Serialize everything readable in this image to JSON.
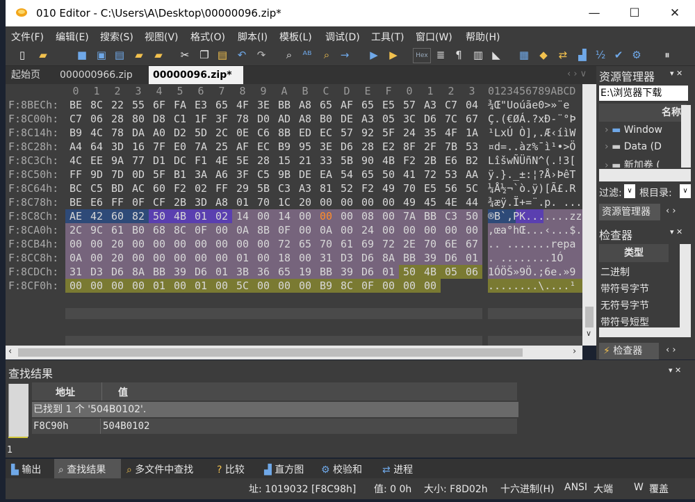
{
  "window": {
    "title": "010 Editor - C:\\Users\\A\\Desktop\\00000096.zip*"
  },
  "menu": [
    "文件(F)",
    "编辑(E)",
    "搜索(S)",
    "视图(V)",
    "格式(O)",
    "脚本(I)",
    "模板(L)",
    "调试(D)",
    "工具(T)",
    "窗口(W)",
    "帮助(H)"
  ],
  "tabs": [
    {
      "label": "起始页"
    },
    {
      "label": "000000966.zip"
    },
    {
      "label": "00000096.zip*"
    }
  ],
  "hex": {
    "col_headers": [
      "0",
      "1",
      "2",
      "3",
      "4",
      "5",
      "6",
      "7",
      "8",
      "9",
      "A",
      "B",
      "C",
      "D",
      "E",
      "F",
      "0",
      "1",
      "2",
      "3"
    ],
    "ascii_header": "0123456789ABCD",
    "rows": [
      {
        "addr": "F:8BECh:",
        "bytes": [
          "BE",
          "8C",
          "22",
          "55",
          "6F",
          "FA",
          "E3",
          "65",
          "4F",
          "3E",
          "BB",
          "A8",
          "65",
          "AF",
          "65",
          "E5",
          "57",
          "A3",
          "C7",
          "04"
        ],
        "ascii": "¾Œ\"Uoúãe0>»¨e"
      },
      {
        "addr": "F:8C00h:",
        "bytes": [
          "C7",
          "06",
          "28",
          "80",
          "D8",
          "C1",
          "1F",
          "3F",
          "78",
          "D0",
          "AD",
          "A8",
          "B0",
          "DE",
          "A3",
          "05",
          "3C",
          "D6",
          "7C",
          "67"
        ],
        "ascii": "Ç.(€ØÁ.?xÐ-¨°Þ"
      },
      {
        "addr": "F:8C14h:",
        "bytes": [
          "B9",
          "4C",
          "78",
          "DA",
          "A0",
          "D2",
          "5D",
          "2C",
          "0E",
          "C6",
          "8B",
          "ED",
          "EC",
          "57",
          "92",
          "5F",
          "24",
          "35",
          "4F",
          "1A"
        ],
        "ascii": "¹LxÚ Ò],.Æ‹íìW"
      },
      {
        "addr": "F:8C28h:",
        "bytes": [
          "A4",
          "64",
          "3D",
          "16",
          "7F",
          "E0",
          "7A",
          "25",
          "AF",
          "EC",
          "B9",
          "95",
          "3E",
          "D6",
          "28",
          "E2",
          "8F",
          "2F",
          "7B",
          "53"
        ],
        "ascii": "¤d=..àz%¯ì¹•>Ö"
      },
      {
        "addr": "F:8C3Ch:",
        "bytes": [
          "4C",
          "EE",
          "9A",
          "77",
          "D1",
          "DC",
          "F1",
          "4E",
          "5E",
          "28",
          "15",
          "21",
          "33",
          "5B",
          "90",
          "4B",
          "F2",
          "2B",
          "E6",
          "B2"
        ],
        "ascii": "LîšwÑÜñN^(.!3["
      },
      {
        "addr": "F:8C50h:",
        "bytes": [
          "FF",
          "9D",
          "7D",
          "0D",
          "5F",
          "B1",
          "3A",
          "A6",
          "3F",
          "C5",
          "9B",
          "DE",
          "EA",
          "54",
          "65",
          "50",
          "41",
          "72",
          "53",
          "AA"
        ],
        "ascii": "ÿ.}._±:¦?Å›ÞêT"
      },
      {
        "addr": "F:8C64h:",
        "bytes": [
          "BC",
          "C5",
          "BD",
          "AC",
          "60",
          "F2",
          "02",
          "FF",
          "29",
          "5B",
          "C3",
          "A3",
          "81",
          "52",
          "F2",
          "49",
          "70",
          "E5",
          "56",
          "5C"
        ],
        "ascii": "¼Å½¬`ò.ÿ)[Ã£.R"
      },
      {
        "addr": "F:8C78h:",
        "bytes": [
          "BE",
          "E6",
          "FF",
          "0F",
          "CF",
          "2B",
          "3D",
          "A8",
          "01",
          "70",
          "1C",
          "20",
          "00",
          "00",
          "00",
          "00",
          "49",
          "45",
          "4E",
          "44"
        ],
        "ascii": "¾æÿ.Ï+=¨.p. ...."
      },
      {
        "addr": "F:8C8Ch:",
        "bytes": [
          "AE",
          "42",
          "60",
          "82",
          "50",
          "4B",
          "01",
          "02",
          "14",
          "00",
          "14",
          "00",
          "00",
          "00",
          "08",
          "00",
          "7A",
          "BB",
          "C3",
          "50"
        ],
        "ascii": "®B`‚PK.......zzz"
      },
      {
        "addr": "F:8CA0h:",
        "bytes": [
          "2C",
          "9C",
          "61",
          "B0",
          "68",
          "8C",
          "0F",
          "00",
          "0A",
          "8B",
          "0F",
          "00",
          "0A",
          "00",
          "24",
          "00",
          "00",
          "00",
          "00",
          "00"
        ],
        "ascii": ",œa°hŒ...‹...$."
      },
      {
        "addr": "F:8CB4h:",
        "bytes": [
          "00",
          "00",
          "20",
          "00",
          "00",
          "00",
          "00",
          "00",
          "00",
          "00",
          "72",
          "65",
          "70",
          "61",
          "69",
          "72",
          "2E",
          "70",
          "6E",
          "67"
        ],
        "ascii": ".. .......repa"
      },
      {
        "addr": "F:8CC8h:",
        "bytes": [
          "0A",
          "00",
          "20",
          "00",
          "00",
          "00",
          "00",
          "00",
          "01",
          "00",
          "18",
          "00",
          "31",
          "D3",
          "D6",
          "8A",
          "BB",
          "39",
          "D6",
          "01"
        ],
        "ascii": ". ........1Ó"
      },
      {
        "addr": "F:8CDCh:",
        "bytes": [
          "31",
          "D3",
          "D6",
          "8A",
          "BB",
          "39",
          "D6",
          "01",
          "3B",
          "36",
          "65",
          "19",
          "BB",
          "39",
          "D6",
          "01",
          "50",
          "4B",
          "05",
          "06"
        ],
        "ascii": "1ÓÖŠ»9Ö.;6e.»9"
      },
      {
        "addr": "F:8CF0h:",
        "bytes": [
          "00",
          "00",
          "00",
          "00",
          "01",
          "00",
          "01",
          "00",
          "5C",
          "00",
          "00",
          "00",
          "B9",
          "8C",
          "0F",
          "00",
          "00",
          "00"
        ],
        "ascii": "........\\....¹"
      }
    ]
  },
  "right_panel": {
    "title": "资源管理器",
    "path": "E:\\浏览器下载",
    "name_header": "名称",
    "tree": [
      "Window",
      "Data (D",
      "新加卷 ("
    ],
    "filter_label": "过滤:",
    "root_label": "根目录:",
    "tab_label": "资源管理器",
    "inspector_title": "检查器",
    "type_header": "类型",
    "types": [
      "二进制",
      "带符号字节",
      "无符号字节",
      "带符号短型"
    ],
    "inspector_tab": "检查器"
  },
  "find_panel": {
    "title": "查找结果",
    "col_address": "地址",
    "col_value": "值",
    "summary": "已找到 1 个 '504B0102'.",
    "result_address": "F8C90h",
    "result_value": "504B0102",
    "left_number": "1"
  },
  "bottom_tabs": [
    "输出",
    "查找结果",
    "多文件中查找",
    "比较",
    "直方图",
    "校验和",
    "进程"
  ],
  "status": {
    "address": "址: 1019032 [F8C98h]",
    "value": "值: 0 0h",
    "size": "大小: F8D02h",
    "mode": "十六进制(H)",
    "encoding": "ANSI",
    "endian": "大端",
    "w": "W",
    "overwrite": "覆盖"
  },
  "colors": {
    "hex_bg": "#3d3d3d",
    "sel_blue": "#3a4a8a",
    "sel_purple": "#5a4aa8",
    "sel_lilac": "#7a6a88",
    "sel_olive": "#7a7a3a"
  }
}
